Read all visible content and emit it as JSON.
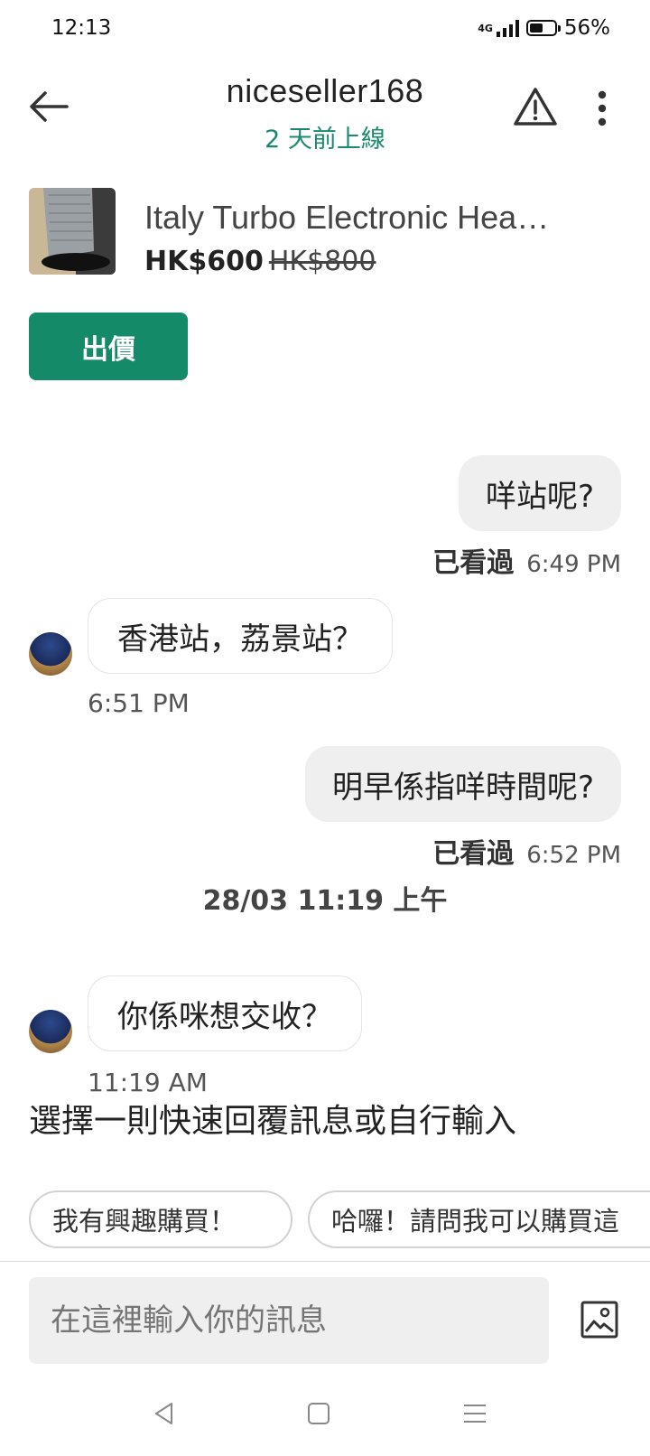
{
  "status_bar": {
    "time": "12:13",
    "network": "4G",
    "battery": "56%",
    "battery_level": 0.56
  },
  "header": {
    "back_icon": "arrow-left-icon",
    "title": "niceseller168",
    "subtitle": "2 天前上線",
    "report_icon": "warning-triangle-icon",
    "more_icon": "more-vertical-icon"
  },
  "product": {
    "title": "Italy Turbo Electronic Hea…",
    "price": "HK$600",
    "original_price": "HK$800",
    "offer_button": "出價"
  },
  "messages": [
    {
      "dir": "out",
      "text": "咩站呢?",
      "status": "已看過",
      "time": "6:49 PM"
    },
    {
      "dir": "in",
      "text": "香港站，荔景站？",
      "time": "6:51 PM"
    },
    {
      "dir": "out",
      "text": "明早係指咩時間呢?",
      "status": "已看過",
      "time": "6:52 PM"
    },
    {
      "dir": "in",
      "text": "你係咪想交收？",
      "time": "11:19 AM"
    }
  ],
  "date_separator": "28/03 11:19 上午",
  "quick_reply": {
    "prompt": "選擇一則快速回覆訊息或自行輸入",
    "chips": [
      "我有興趣購買！",
      "哈囉！請問我可以購買這"
    ]
  },
  "composer": {
    "placeholder": "在這裡輸入你的訊息",
    "image_icon": "image-upload-icon"
  },
  "colors": {
    "accent": "#158a68",
    "online": "#1a8a6e",
    "bubble_out": "#efefef"
  }
}
